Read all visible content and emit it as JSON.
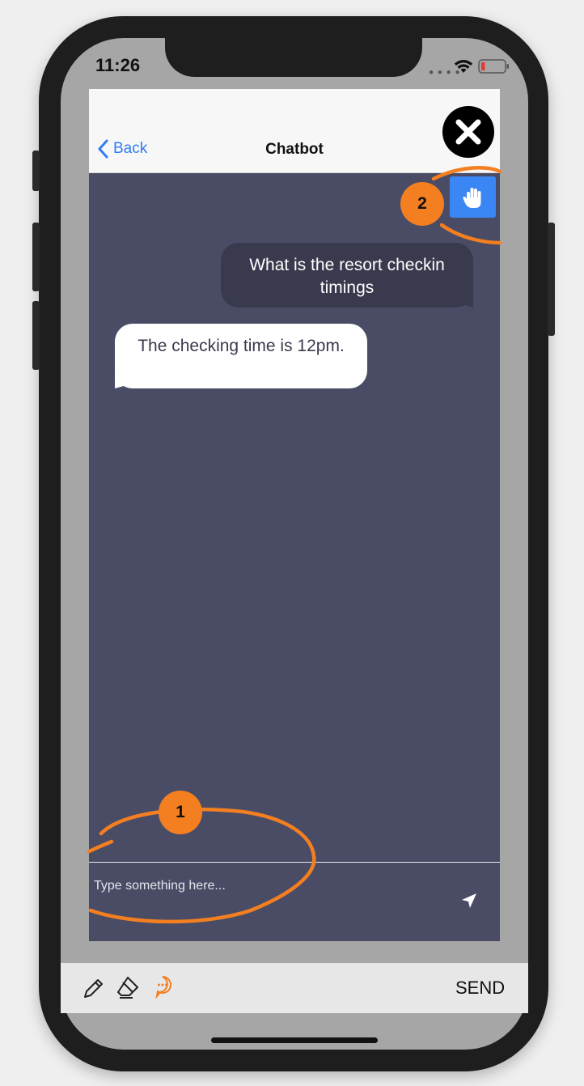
{
  "status_bar": {
    "time": "11:26"
  },
  "nav": {
    "back_label": "Back",
    "title": "Chatbot"
  },
  "messages": [
    {
      "sender": "user",
      "text": "What is the resort checkin timings"
    },
    {
      "sender": "bot",
      "text": "The checking time is 12pm."
    }
  ],
  "composer": {
    "placeholder": "Type something here...",
    "value": ""
  },
  "annotations": [
    {
      "number": "1",
      "color": "#f37f21"
    },
    {
      "number": "2",
      "color": "#f37f21"
    }
  ],
  "markup_toolbar": {
    "tools": [
      "pencil-icon",
      "eraser-icon",
      "speech-bubble-icon"
    ],
    "send_label": "SEND"
  },
  "colors": {
    "chat_background": "#4a4c66",
    "user_bubble": "#393a4d",
    "bot_bubble": "#ffffff",
    "accent_blue": "#2f7cf6",
    "annotation_orange": "#f37f21"
  }
}
